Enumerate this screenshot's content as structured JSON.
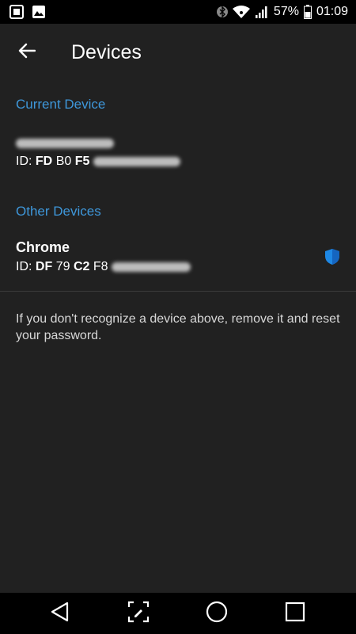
{
  "status_bar": {
    "battery_percent": "57%",
    "time": "01:09",
    "icons": [
      "gallery-icon",
      "image-icon",
      "bluetooth-icon",
      "wifi-icon",
      "signal-icon",
      "battery-icon"
    ]
  },
  "app_bar": {
    "title": "Devices",
    "back_icon": "arrow-left-icon"
  },
  "current_device": {
    "header": "Current Device",
    "name": "",
    "id_label": "ID:",
    "id_parts": [
      "FD",
      "B0",
      "F5"
    ]
  },
  "other_devices": {
    "header": "Other Devices",
    "items": [
      {
        "name": "Chrome",
        "id_label": "ID:",
        "id_parts": [
          "DF",
          "79",
          "C2",
          "F8"
        ],
        "icon": "shield-icon"
      }
    ]
  },
  "notice": "If you don't recognize a device above, remove it and reset your password.",
  "nav_bar": {
    "icons": [
      "back-triangle-icon",
      "screenshot-edit-icon",
      "home-circle-icon",
      "recents-square-icon"
    ]
  },
  "colors": {
    "background": "#212121",
    "accent": "#3e97da",
    "status_bar": "#000000"
  }
}
